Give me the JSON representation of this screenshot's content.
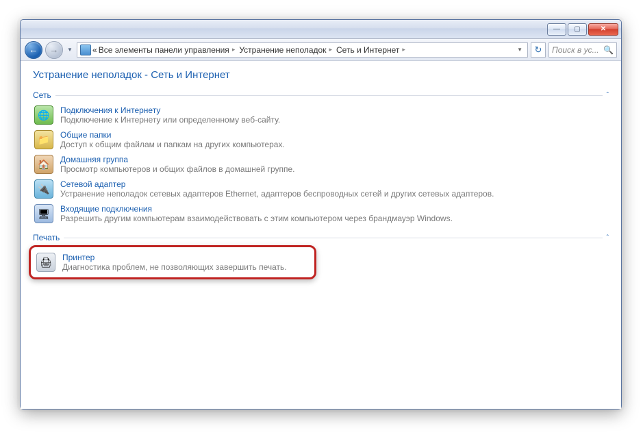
{
  "window": {
    "min_glyph": "—",
    "max_glyph": "▢",
    "close_glyph": "✕"
  },
  "nav": {
    "back_glyph": "←",
    "fwd_glyph": "→",
    "dropdown_glyph": "▼",
    "refresh_glyph": "↻",
    "search_placeholder": "Поиск в ус...",
    "search_glyph": "🔍"
  },
  "breadcrumbs": {
    "prefix": "«",
    "items": [
      "Все элементы панели управления",
      "Устранение неполадок",
      "Сеть и Интернет"
    ],
    "sep": "▸"
  },
  "page_title": "Устранение неполадок - Сеть и Интернет",
  "sections": [
    {
      "name": "Сеть",
      "collapse_glyph": "ˆ",
      "items": [
        {
          "icon": "ic-internet",
          "title": "Подключения к Интернету",
          "desc": "Подключение к Интернету или определенному веб-сайту."
        },
        {
          "icon": "ic-shared",
          "title": "Общие папки",
          "desc": "Доступ к общим файлам и папкам на других компьютерах."
        },
        {
          "icon": "ic-home",
          "title": "Домашняя группа",
          "desc": "Просмотр компьютеров и общих файлов в домашней группе."
        },
        {
          "icon": "ic-adapter",
          "title": "Сетевой адаптер",
          "desc": "Устранение неполадок сетевых адаптеров Ethernet, адаптеров беспроводных сетей и других сетевых адаптеров."
        },
        {
          "icon": "ic-incoming",
          "title": "Входящие подключения",
          "desc": "Разрешить другим компьютерам взаимодействовать с этим компьютером через брандмауэр Windows."
        }
      ]
    },
    {
      "name": "Печать",
      "collapse_glyph": "ˆ",
      "items": [
        {
          "icon": "ic-printer",
          "title": "Принтер",
          "desc": "Диагностика проблем, не позволяющих завершить печать.",
          "highlighted": true
        }
      ]
    }
  ]
}
